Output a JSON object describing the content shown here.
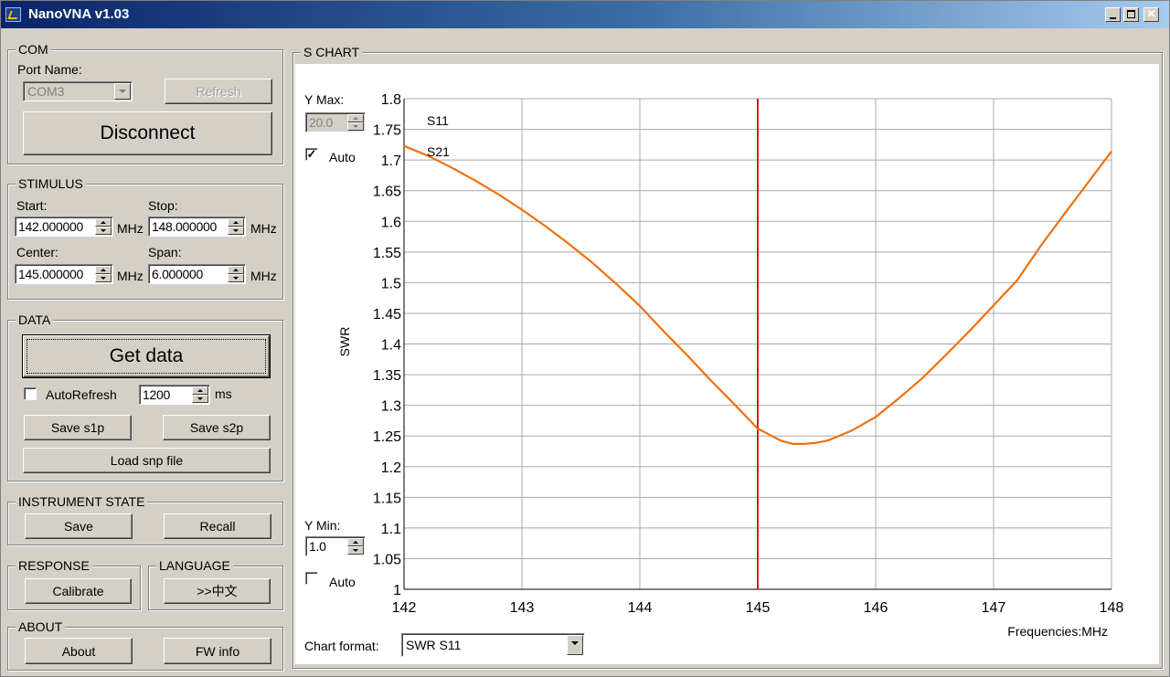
{
  "window": {
    "title": "NanoVNA  v1.03"
  },
  "com": {
    "legend": "COM",
    "port_label": "Port Name:",
    "port_value": "COM3",
    "refresh_label": "Refresh",
    "disconnect_label": "Disconnect"
  },
  "stimulus": {
    "legend": "STIMULUS",
    "start_label": "Start:",
    "start_value": "142.000000",
    "stop_label": "Stop:",
    "stop_value": "148.000000",
    "center_label": "Center:",
    "center_value": "145.000000",
    "span_label": "Span:",
    "span_value": "6.000000",
    "unit": "MHz"
  },
  "data_group": {
    "legend": "DATA",
    "get_data_label": "Get data",
    "autorefresh_label": "AutoRefresh",
    "autorefresh_checked": false,
    "interval_value": "1200",
    "interval_unit": "ms",
    "save_s1p_label": "Save s1p",
    "save_s2p_label": "Save s2p",
    "load_snp_label": "Load snp file"
  },
  "instrument_state": {
    "legend": "INSTRUMENT STATE",
    "save_label": "Save",
    "recall_label": "Recall"
  },
  "response": {
    "legend": "RESPONSE",
    "calibrate_label": "Calibrate"
  },
  "language": {
    "legend": "LANGUAGE",
    "switch_label": ">>中文"
  },
  "about": {
    "legend": "ABOUT",
    "about_label": "About",
    "fw_info_label": "FW info"
  },
  "schart": {
    "legend": "S CHART",
    "ymax_label": "Y Max:",
    "ymax_value": "20.0",
    "ymax_auto_label": "Auto",
    "ymax_auto_checked": true,
    "ymin_label": "Y Min:",
    "ymin_value": "1.0",
    "ymin_auto_label": "Auto",
    "ymin_auto_checked": false,
    "chart_format_label": "Chart format:",
    "chart_format_value": "SWR S11"
  },
  "colors": {
    "s11": "#f07010",
    "s21": "#2020c0",
    "marker": "#d02020",
    "grid": "#a8a8a8"
  },
  "chart_data": {
    "type": "line",
    "title": "",
    "xlabel": "Frequencies:MHz",
    "ylabel": "SWR",
    "xlim": [
      142,
      148
    ],
    "ylim": [
      1,
      1.8
    ],
    "xticks": [
      "142",
      "143",
      "144",
      "145",
      "146",
      "147",
      "148"
    ],
    "yticks": [
      "1.8",
      "1.75",
      "1.7",
      "1.65",
      "1.6",
      "1.55",
      "1.5",
      "1.45",
      "1.4",
      "1.35",
      "1.3",
      "1.25",
      "1.2",
      "1.15",
      "1.1",
      "1.05",
      "1"
    ],
    "grid": true,
    "legend": [
      "S11",
      "S21"
    ],
    "marker_x": 145,
    "series": [
      {
        "name": "S11",
        "x": [
          142.0,
          142.2,
          142.4,
          142.6,
          142.8,
          143.0,
          143.2,
          143.4,
          143.6,
          143.8,
          144.0,
          144.2,
          144.4,
          144.6,
          144.8,
          145.0,
          145.1,
          145.2,
          145.3,
          145.4,
          145.5,
          145.6,
          145.8,
          146.0,
          146.2,
          146.4,
          146.6,
          146.8,
          147.0,
          147.2,
          147.4,
          147.6,
          147.8,
          148.0
        ],
        "values": [
          1.723,
          1.707,
          1.688,
          1.667,
          1.644,
          1.619,
          1.592,
          1.563,
          1.532,
          1.498,
          1.462,
          1.421,
          1.382,
          1.341,
          1.302,
          1.262,
          1.252,
          1.242,
          1.237,
          1.237,
          1.239,
          1.243,
          1.259,
          1.281,
          1.312,
          1.345,
          1.383,
          1.422,
          1.463,
          1.504,
          1.56,
          1.612,
          1.663,
          1.714
        ]
      },
      {
        "name": "S21",
        "x": [],
        "values": []
      }
    ]
  }
}
